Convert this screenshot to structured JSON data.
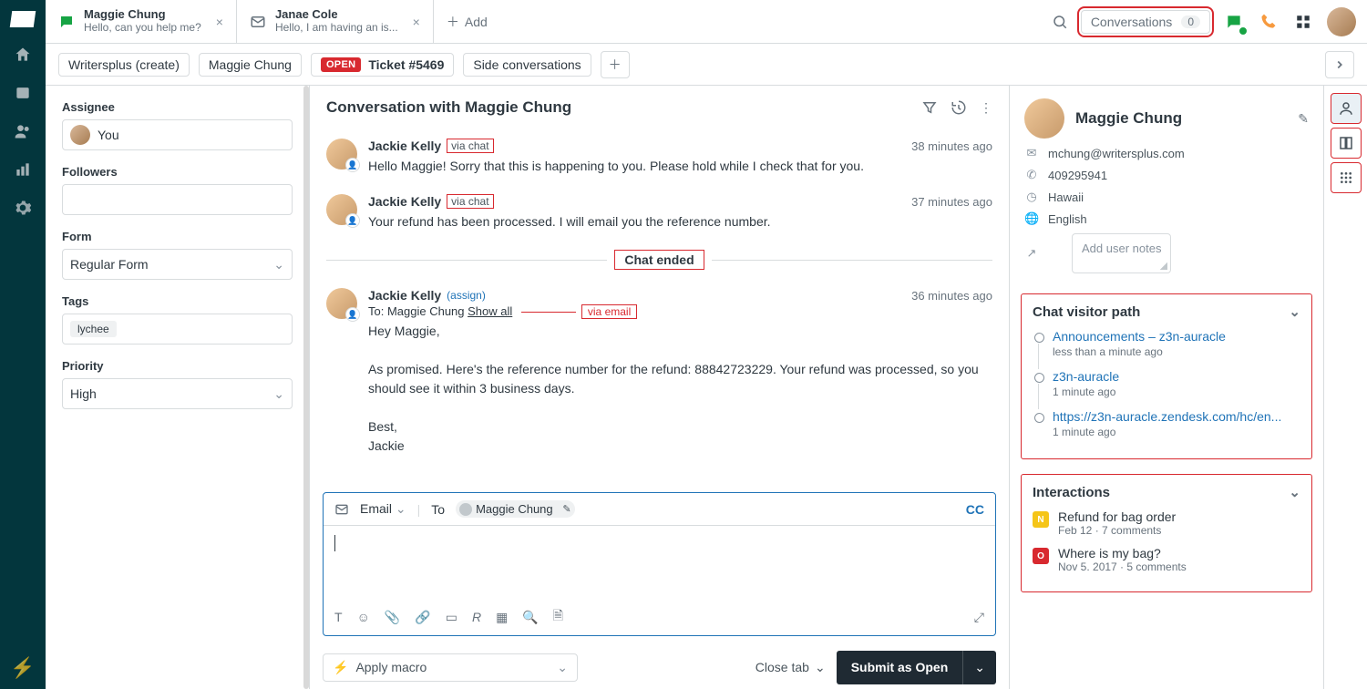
{
  "topTabs": [
    {
      "icon": "chat",
      "status": "online",
      "title": "Maggie Chung",
      "sub": "Hello, can you help me?"
    },
    {
      "icon": "mail",
      "title": "Janae Cole",
      "sub": "Hello, I am having an is..."
    }
  ],
  "addTab": "Add",
  "conversations": {
    "label": "Conversations",
    "count": "0"
  },
  "breadcrumb": {
    "org": "Writersplus (create)",
    "person": "Maggie Chung",
    "badge": "OPEN",
    "ticket": "Ticket #5469"
  },
  "sideConv": "Side conversations",
  "left": {
    "assignee": {
      "label": "Assignee",
      "value": "You"
    },
    "followers": {
      "label": "Followers",
      "value": ""
    },
    "form": {
      "label": "Form",
      "value": "Regular Form"
    },
    "tags": {
      "label": "Tags",
      "items": [
        "lychee"
      ]
    },
    "priority": {
      "label": "Priority",
      "value": "High"
    }
  },
  "center": {
    "title": "Conversation with Maggie Chung",
    "msgs": [
      {
        "author": "Jackie Kelly",
        "via": "via chat",
        "ts": "38 minutes ago",
        "body": "Hello Maggie! Sorry that this is happening to you. Please hold while I check that for you."
      },
      {
        "author": "Jackie Kelly",
        "via": "via chat",
        "ts": "37 minutes ago",
        "body": "Your refund has been processed. I will email you the reference number."
      }
    ],
    "ended": "Chat ended",
    "email": {
      "author": "Jackie Kelly",
      "assign": "(assign)",
      "ts": "36 minutes ago",
      "to": "To: Maggie Chung ",
      "showall": "Show all",
      "annot": "via email",
      "lines": [
        "Hey Maggie,",
        "",
        "As promised. Here's the reference number for the refund: 88842723229. Your refund was processed, so you should see it within 3 business days.",
        "",
        "Best,",
        "Jackie"
      ]
    },
    "composer": {
      "channel": "Email",
      "to": "To",
      "chip": "Maggie Chung",
      "cc": "CC"
    }
  },
  "customer": {
    "name": "Maggie Chung",
    "email": "mchung@writersplus.com",
    "phone": "409295941",
    "location": "Hawaii",
    "language": "English",
    "notesPlaceholder": "Add user notes"
  },
  "visitorPath": {
    "title": "Chat visitor path",
    "items": [
      {
        "label": "Announcements – z3n-auracle",
        "time": "less than a minute ago"
      },
      {
        "label": "z3n-auracle",
        "time": "1 minute ago"
      },
      {
        "label": "https://z3n-auracle.zendesk.com/hc/en...",
        "time": "1 minute ago"
      }
    ]
  },
  "interactions": {
    "title": "Interactions",
    "items": [
      {
        "badge": "N",
        "title": "Refund for bag order",
        "meta": "Feb 12 · 7 comments"
      },
      {
        "badge": "O",
        "title": "Where is my bag?",
        "meta": "Nov 5. 2017 · 5 comments"
      }
    ]
  },
  "footer": {
    "macro": "Apply macro",
    "close": "Close tab",
    "submit": "Submit as Open"
  }
}
